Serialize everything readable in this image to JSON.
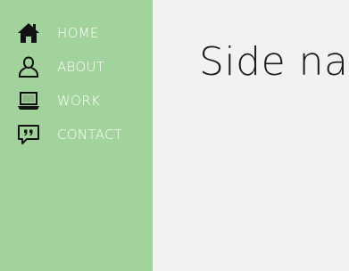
{
  "sidebar": {
    "items": [
      {
        "label": "HOME",
        "icon": "home-icon"
      },
      {
        "label": "ABOUT",
        "icon": "user-icon"
      },
      {
        "label": "WORK",
        "icon": "laptop-icon"
      },
      {
        "label": "CONTACT",
        "icon": "chat-icon"
      }
    ]
  },
  "main": {
    "title": "Side nav"
  },
  "colors": {
    "sidebar_bg": "#a3d39c",
    "main_bg": "#f2f2f2",
    "nav_text": "#ffffff",
    "title_text": "#1a1a1a"
  }
}
